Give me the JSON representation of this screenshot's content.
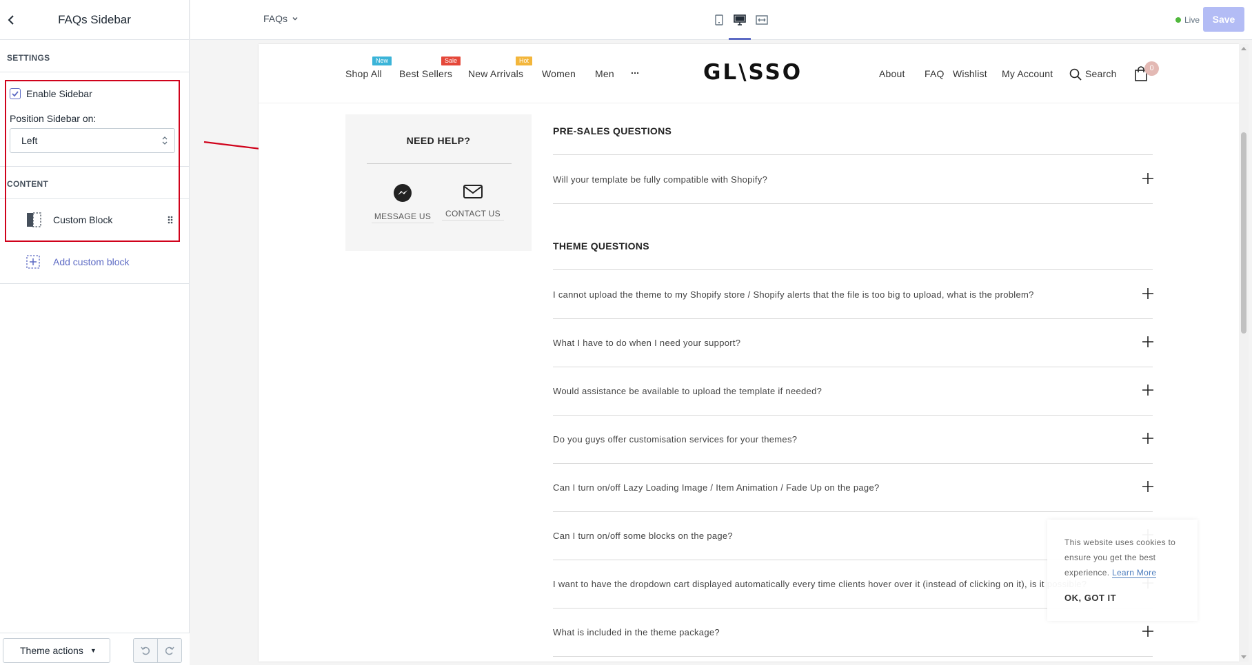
{
  "editor": {
    "sidebar_title": "FAQs Sidebar",
    "settings_heading": "SETTINGS",
    "enable_sidebar_label": "Enable Sidebar",
    "enable_sidebar_checked": true,
    "position_label": "Position Sidebar on:",
    "position_value": "Left",
    "content_heading": "CONTENT",
    "custom_block_label": "Custom Block",
    "add_block_label": "Add custom block",
    "theme_actions_label": "Theme actions",
    "accent_color": "#5c6ac4",
    "highlight_color": "#d0021b"
  },
  "topbar": {
    "page_select": "FAQs",
    "live_label": "Live",
    "save_label": "Save",
    "active_view": "desktop"
  },
  "store": {
    "logo": "GL\\SSO",
    "nav_left": [
      {
        "label": "Shop All",
        "badge": "New",
        "badge_color": "#3bb4d8"
      },
      {
        "label": "Best Sellers",
        "badge": "Sale",
        "badge_color": "#e5483a"
      },
      {
        "label": "New Arrivals",
        "badge": "Hot",
        "badge_color": "#f3b63b"
      },
      {
        "label": "Women",
        "badge": "",
        "badge_color": ""
      },
      {
        "label": "Men",
        "badge": "",
        "badge_color": ""
      },
      {
        "label": "...",
        "badge": "",
        "badge_color": ""
      }
    ],
    "nav_right": [
      "About",
      "FAQ",
      "Wishlist",
      "My Account"
    ],
    "search_label": "Search",
    "cart_count": "0"
  },
  "help": {
    "title": "NEED HELP?",
    "message_label": "MESSAGE US",
    "contact_label": "CONTACT US"
  },
  "faq": {
    "presales_heading": "PRE-SALES QUESTIONS",
    "presales_questions": [
      "Will your template be fully compatible with Shopify?"
    ],
    "theme_heading": "THEME QUESTIONS",
    "theme_questions": [
      "I cannot upload the theme to my Shopify store / Shopify alerts that the file is too big to upload, what is the problem?",
      "What I have to do when I need your support?",
      "Would assistance be available to upload the template if needed?",
      "Do you guys offer customisation services for your themes?",
      "Can I turn on/off Lazy Loading Image / Item Animation / Fade Up on the page?",
      "Can I turn on/off some blocks on the page?",
      "I want to have the dropdown cart displayed automatically every time clients hover over it (instead of clicking on it), is it possible?",
      "What is included in the theme package?"
    ]
  },
  "cookie": {
    "text": "This website uses cookies to ensure you get the best experience.",
    "link": "Learn More",
    "ok": "OK, GOT IT"
  }
}
